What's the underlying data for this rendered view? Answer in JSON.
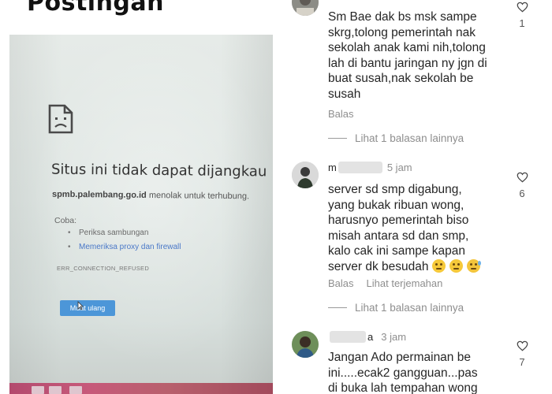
{
  "post": {
    "title": "Postingan"
  },
  "error_page": {
    "title": "Situs ini tidak dapat dijangkau",
    "domain": "spmb.palembang.go.id",
    "message": "menolak untuk terhubung.",
    "try_label": "Coba:",
    "suggestions": [
      "Periksa sambungan",
      "Memeriksa proxy dan firewall"
    ],
    "error_code": "ERR_CONNECTION_REFUSED",
    "reload_label": "Muat ulang"
  },
  "comments": [
    {
      "text": "Sm Bae dak bs msk sampe skrg,tolong pemerintah nak sekolah anak kami nih,tolong lah di bantu jaringan ny jgn di buat susah,nak sekolah be susah",
      "lines": [
        "Sm Bae dak bs msk sampe",
        "skrg,tolong pemerintah nak",
        "sekolah anak kami nih,tolong",
        "lah di bantu jaringan ny jgn di",
        "buat susah,nak sekolah be",
        "susah"
      ],
      "reply_label": "Balas",
      "view_replies": "Lihat 1 balasan lainnya",
      "likes": "1"
    },
    {
      "username_start": "m",
      "time": "5 jam",
      "lines": [
        "server sd smp digabung,",
        "yang bukak ribuan wong,",
        "harusnyo pemerintah biso",
        "misah antara sd dan smp,",
        "kalo cak ini sampe kapan",
        "server dk besudah"
      ],
      "reply_label": "Balas",
      "translate_label": "Lihat terjemahan",
      "view_replies": "Lihat 1 balasan lainnya",
      "likes": "6"
    },
    {
      "username_end": "a",
      "time": "3 jam",
      "lines": [
        "Jangan Ado permainan be",
        "ini.....ecak2 gangguan...pas",
        "di buka lah tempahan wong"
      ],
      "likes": "7"
    }
  ],
  "colors": {
    "link": "#4a78c8",
    "button": "#4c96d8",
    "muted": "#8e8e8e",
    "text": "#262626"
  }
}
